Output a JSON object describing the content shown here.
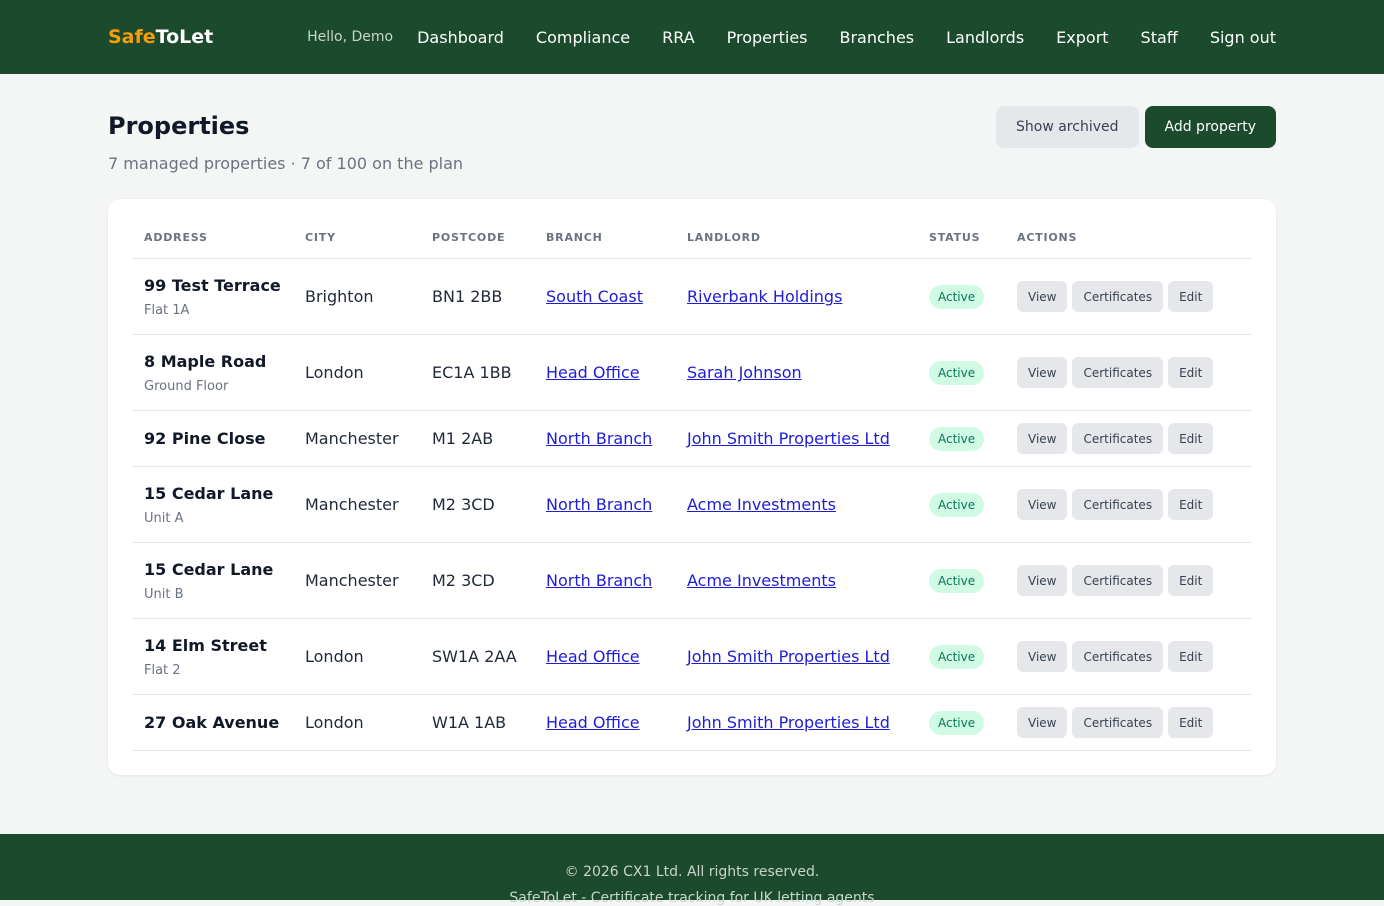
{
  "brand": {
    "part1": "Safe",
    "part2": "ToLet"
  },
  "nav": {
    "greeting": "Hello, Demo",
    "links": [
      "Dashboard",
      "Compliance",
      "RRA",
      "Properties",
      "Branches",
      "Landlords",
      "Export",
      "Staff",
      "Sign out"
    ]
  },
  "page": {
    "title": "Properties",
    "subtitle": "7 managed properties · 7 of 100 on the plan",
    "show_archived": "Show archived",
    "add_property": "Add property"
  },
  "table": {
    "headers": [
      "ADDRESS",
      "CITY",
      "POSTCODE",
      "BRANCH",
      "LANDLORD",
      "STATUS",
      "ACTIONS"
    ],
    "action_labels": {
      "view": "View",
      "certificates": "Certificates",
      "edit": "Edit"
    },
    "rows": [
      {
        "address": "99 Test Terrace",
        "sub": "Flat 1A",
        "city": "Brighton",
        "postcode": "BN1 2BB",
        "branch": "South Coast",
        "landlord": "Riverbank Holdings",
        "status": "Active"
      },
      {
        "address": "8 Maple Road",
        "sub": "Ground Floor",
        "city": "London",
        "postcode": "EC1A 1BB",
        "branch": "Head Office",
        "landlord": "Sarah Johnson",
        "status": "Active"
      },
      {
        "address": "92 Pine Close",
        "sub": "",
        "city": "Manchester",
        "postcode": "M1 2AB",
        "branch": "North Branch",
        "landlord": "John Smith Properties Ltd",
        "status": "Active"
      },
      {
        "address": "15 Cedar Lane",
        "sub": "Unit A",
        "city": "Manchester",
        "postcode": "M2 3CD",
        "branch": "North Branch",
        "landlord": "Acme Investments",
        "status": "Active"
      },
      {
        "address": "15 Cedar Lane",
        "sub": "Unit B",
        "city": "Manchester",
        "postcode": "M2 3CD",
        "branch": "North Branch",
        "landlord": "Acme Investments",
        "status": "Active"
      },
      {
        "address": "14 Elm Street",
        "sub": "Flat 2",
        "city": "London",
        "postcode": "SW1A 2AA",
        "branch": "Head Office",
        "landlord": "John Smith Properties Ltd",
        "status": "Active"
      },
      {
        "address": "27 Oak Avenue",
        "sub": "",
        "city": "London",
        "postcode": "W1A 1AB",
        "branch": "Head Office",
        "landlord": "John Smith Properties Ltd",
        "status": "Active"
      }
    ]
  },
  "footer": {
    "copyright": "© 2026 CX1 Ltd. All rights reserved.",
    "tagline": "SafeToLet - Certificate tracking for UK letting agents"
  },
  "colors": {
    "header_bg": "#1c4a2c",
    "brand_accent": "#f59e0b",
    "badge_bg": "#d1fae5",
    "badge_text": "#047857",
    "link": "#1d1dd6"
  }
}
